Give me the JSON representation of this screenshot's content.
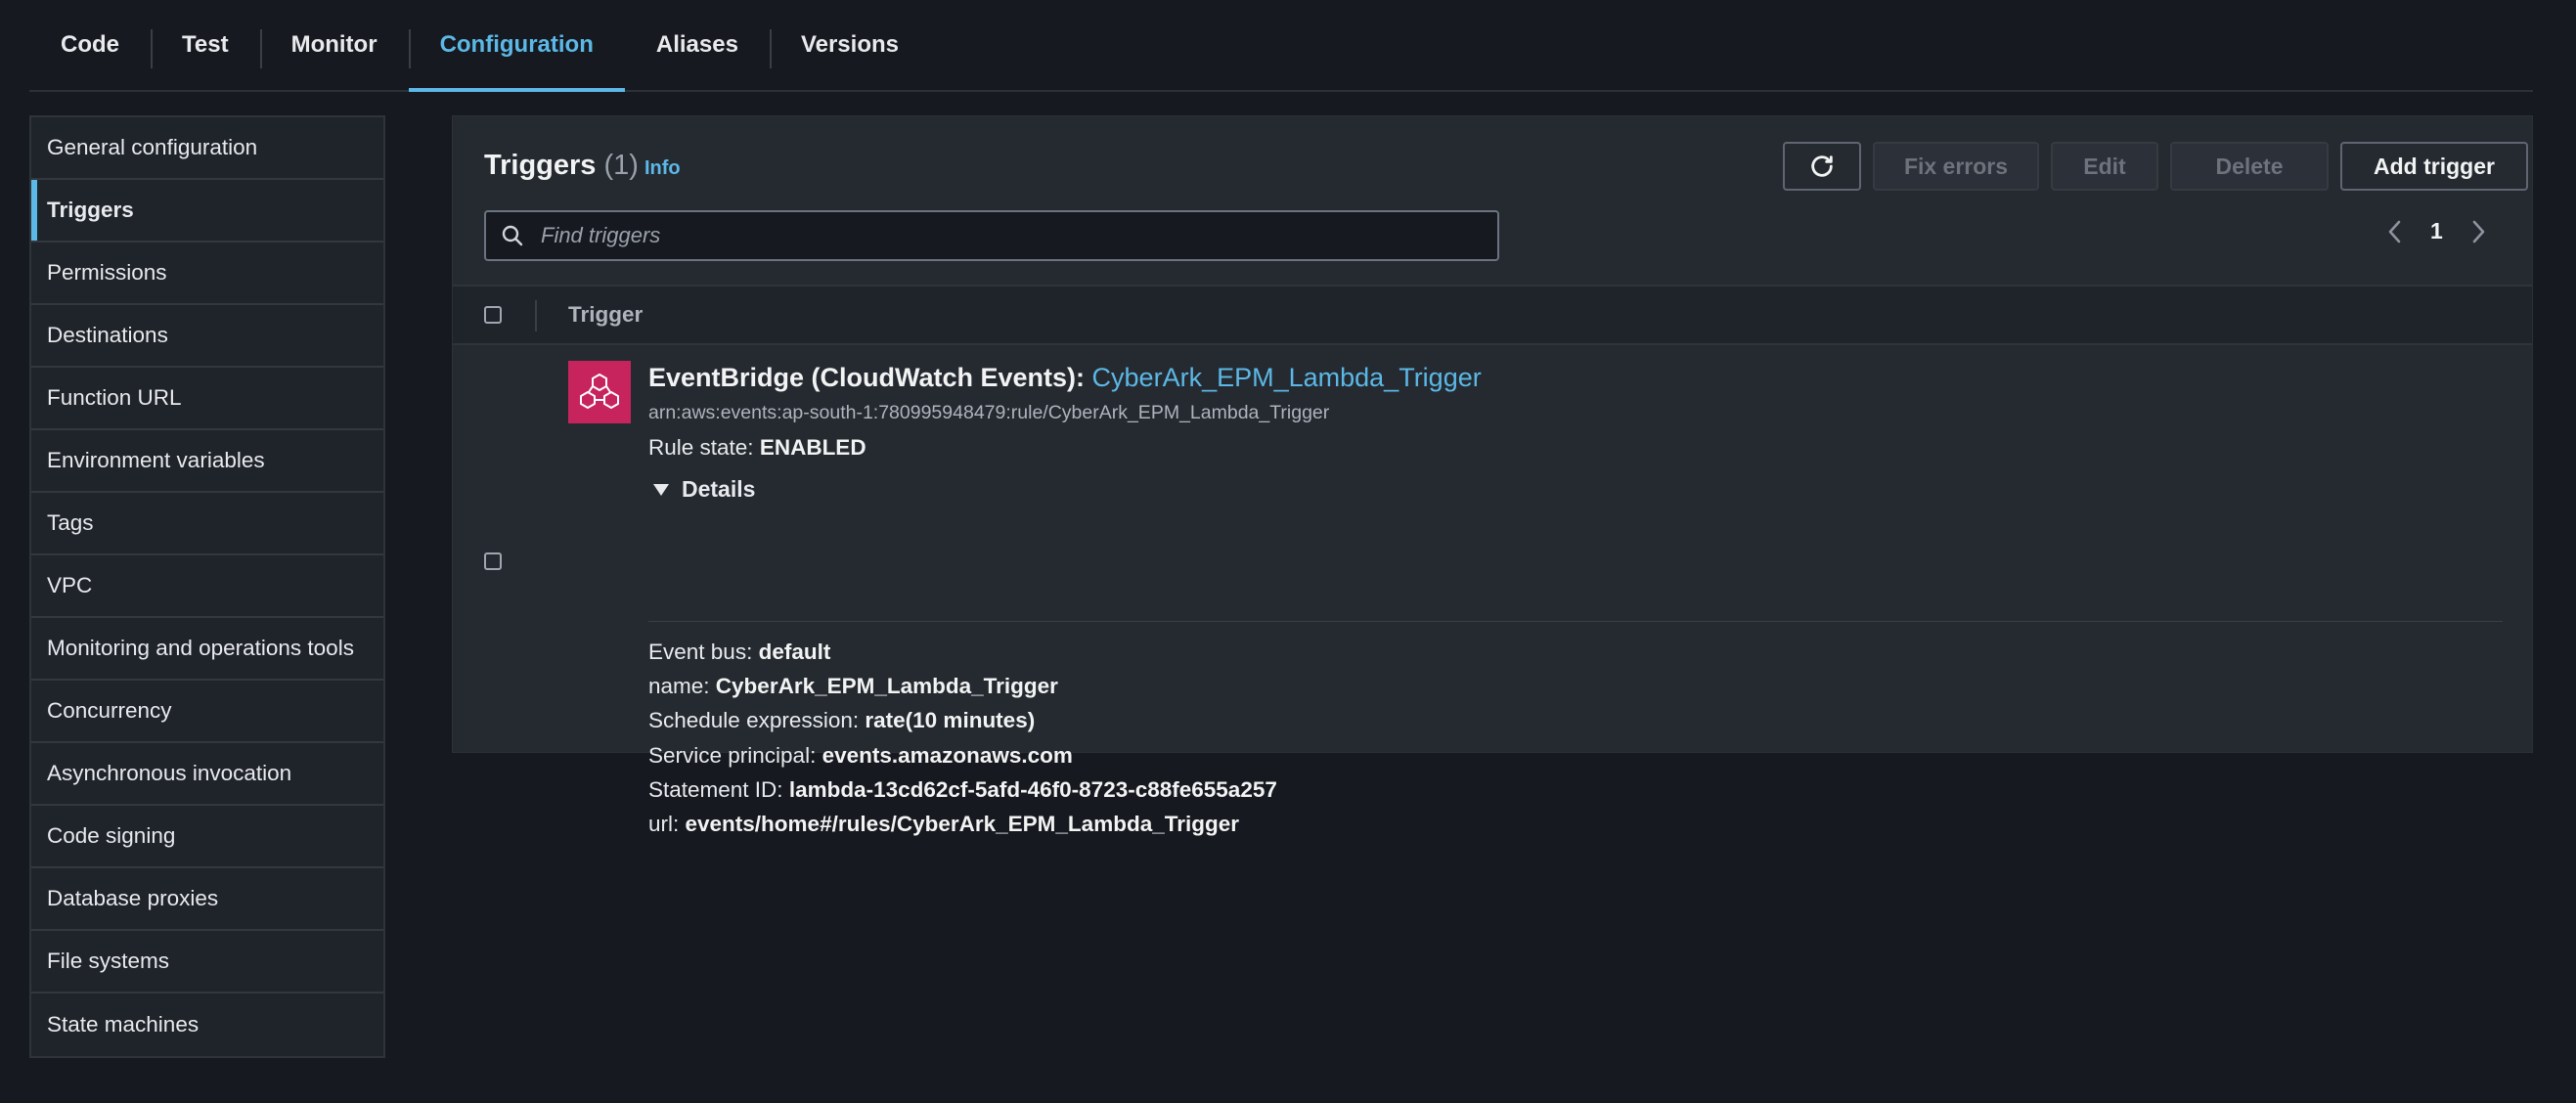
{
  "tabs": [
    {
      "label": "Code"
    },
    {
      "label": "Test"
    },
    {
      "label": "Monitor"
    },
    {
      "label": "Configuration"
    },
    {
      "label": "Aliases"
    },
    {
      "label": "Versions"
    }
  ],
  "active_tab": "Configuration",
  "sidebar": {
    "items": [
      {
        "label": "General configuration"
      },
      {
        "label": "Triggers"
      },
      {
        "label": "Permissions"
      },
      {
        "label": "Destinations"
      },
      {
        "label": "Function URL"
      },
      {
        "label": "Environment variables"
      },
      {
        "label": "Tags"
      },
      {
        "label": "VPC"
      },
      {
        "label": "Monitoring and operations tools"
      },
      {
        "label": "Concurrency"
      },
      {
        "label": "Asynchronous invocation"
      },
      {
        "label": "Code signing"
      },
      {
        "label": "Database proxies"
      },
      {
        "label": "File systems"
      },
      {
        "label": "State machines"
      }
    ],
    "active": "Triggers"
  },
  "panel": {
    "title": "Triggers",
    "count": "(1)",
    "info": "Info",
    "buttons": {
      "refresh_icon": "refresh-icon",
      "fix_errors": "Fix errors",
      "edit": "Edit",
      "delete": "Delete",
      "add_trigger": "Add trigger"
    },
    "search": {
      "placeholder": "Find triggers",
      "value": ""
    },
    "pagination": {
      "current_page": "1"
    },
    "table": {
      "column_header": "Trigger",
      "rows": [
        {
          "service": "EventBridge (CloudWatch Events)",
          "separator": ": ",
          "name_link": "CyberArk_EPM_Lambda_Trigger",
          "arn": "arn:aws:events:ap-south-1:780995948479:rule/CyberArk_EPM_Lambda_Trigger",
          "rule_state_label": "Rule state: ",
          "rule_state_value": "ENABLED",
          "details_label": "Details",
          "details": [
            {
              "key": "Event bus: ",
              "value": "default"
            },
            {
              "key": "name: ",
              "value": "CyberArk_EPM_Lambda_Trigger"
            },
            {
              "key": "Schedule expression: ",
              "value": "rate(10 minutes)"
            },
            {
              "key": "Service principal: ",
              "value": "events.amazonaws.com"
            },
            {
              "key": "Statement ID: ",
              "value": "lambda-13cd62cf-5afd-46f0-8723-c88fe655a257"
            },
            {
              "key": "url: ",
              "value": "events/home#/rules/CyberArk_EPM_Lambda_Trigger"
            }
          ]
        }
      ]
    }
  },
  "colors": {
    "accent": "#5cb8e6",
    "eventbridge": "#c7245e",
    "background": "#16191f",
    "panel": "#252a31"
  }
}
